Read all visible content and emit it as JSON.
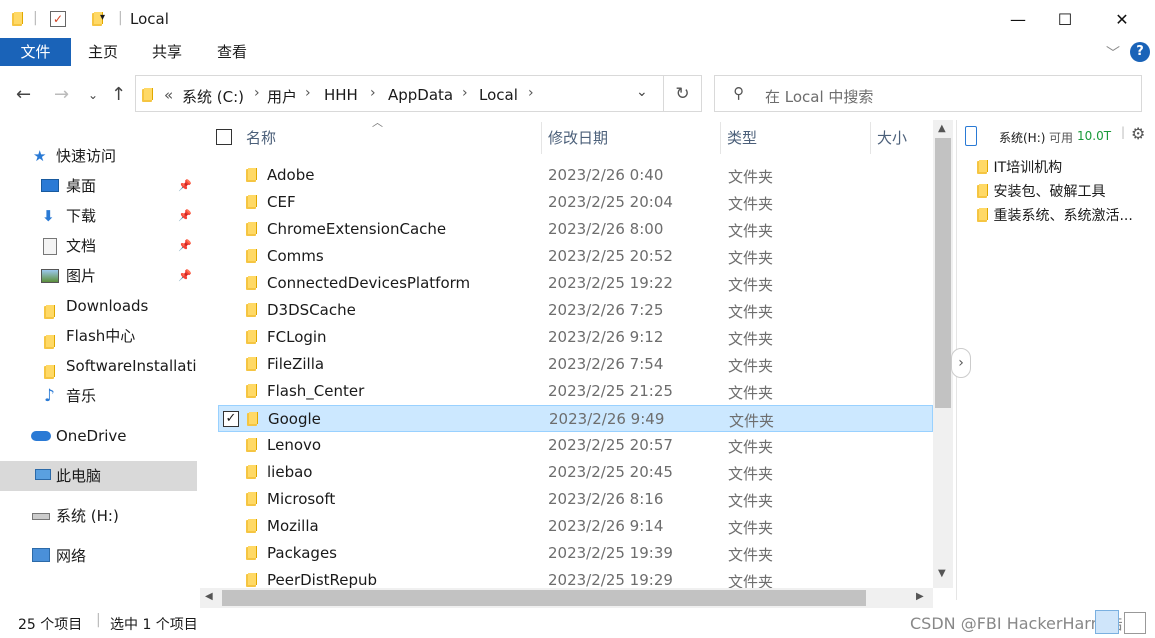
{
  "window": {
    "title": "Local",
    "minimize": "—",
    "maximize": "☐",
    "close": "✕"
  },
  "ribbon": {
    "tabs": [
      "文件",
      "主页",
      "共享",
      "查看"
    ]
  },
  "address": {
    "prefix": "«",
    "crumbs": [
      "系统 (C:)",
      "用户",
      "HHH",
      "AppData",
      "Local"
    ]
  },
  "search": {
    "placeholder": "在 Local 中搜索"
  },
  "sidebar": {
    "items": [
      {
        "label": "快速访问"
      },
      {
        "label": "桌面"
      },
      {
        "label": "下载"
      },
      {
        "label": "文档"
      },
      {
        "label": "图片"
      },
      {
        "label": "Downloads"
      },
      {
        "label": "Flash中心"
      },
      {
        "label": "SoftwareInstallatio"
      },
      {
        "label": "音乐"
      },
      {
        "label": "OneDrive"
      },
      {
        "label": "此电脑"
      },
      {
        "label": "系统 (H:)"
      },
      {
        "label": "网络"
      }
    ]
  },
  "columns": {
    "name": "名称",
    "date": "修改日期",
    "type": "类型",
    "size": "大小"
  },
  "files": [
    {
      "name": "Adobe",
      "date": "2023/2/26 0:40",
      "type": "文件夹"
    },
    {
      "name": "CEF",
      "date": "2023/2/25 20:04",
      "type": "文件夹"
    },
    {
      "name": "ChromeExtensionCache",
      "date": "2023/2/26 8:00",
      "type": "文件夹"
    },
    {
      "name": "Comms",
      "date": "2023/2/25 20:52",
      "type": "文件夹"
    },
    {
      "name": "ConnectedDevicesPlatform",
      "date": "2023/2/25 19:22",
      "type": "文件夹"
    },
    {
      "name": "D3DSCache",
      "date": "2023/2/26 7:25",
      "type": "文件夹"
    },
    {
      "name": "FCLogin",
      "date": "2023/2/26 9:12",
      "type": "文件夹"
    },
    {
      "name": "FileZilla",
      "date": "2023/2/26 7:54",
      "type": "文件夹"
    },
    {
      "name": "Flash_Center",
      "date": "2023/2/25 21:25",
      "type": "文件夹"
    },
    {
      "name": "Google",
      "date": "2023/2/26 9:49",
      "type": "文件夹"
    },
    {
      "name": "Lenovo",
      "date": "2023/2/25 20:57",
      "type": "文件夹"
    },
    {
      "name": "liebao",
      "date": "2023/2/25 20:45",
      "type": "文件夹"
    },
    {
      "name": "Microsoft",
      "date": "2023/2/26 8:16",
      "type": "文件夹"
    },
    {
      "name": "Mozilla",
      "date": "2023/2/26 9:14",
      "type": "文件夹"
    },
    {
      "name": "Packages",
      "date": "2023/2/25 19:39",
      "type": "文件夹"
    },
    {
      "name": "PeerDistRepub",
      "date": "2023/2/25 19:29",
      "type": "文件夹"
    }
  ],
  "selected_file": "Google",
  "right_pane": {
    "drive": "系统(H:)",
    "free_label": "可用",
    "free_value": "10.0T",
    "items": [
      "IT培训机构",
      "安装包、破解工具",
      "重装系统、系统激活..."
    ]
  },
  "status": {
    "count": "25 个项目",
    "selected": "选中 1 个项目"
  },
  "watermark": "CSDN @FBI HackerHarry浩",
  "colors": {
    "accent": "#1a63b8",
    "selection": "#cce8ff",
    "folder": "#f5c542"
  }
}
